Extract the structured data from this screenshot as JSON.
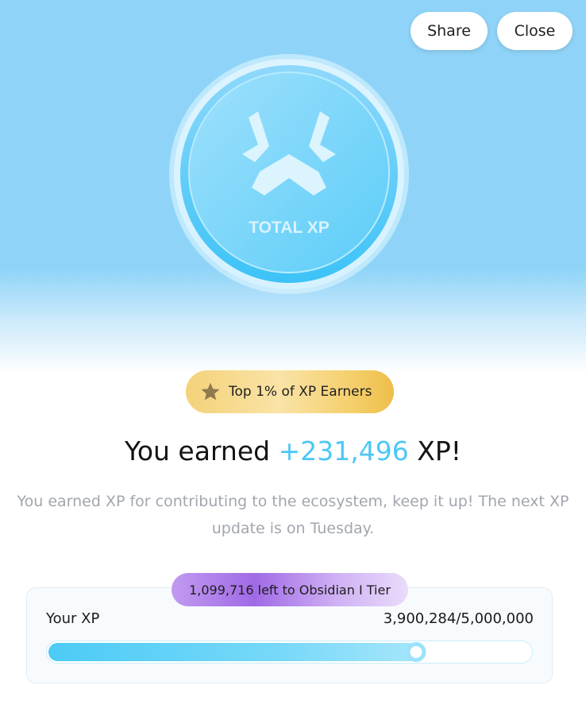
{
  "header": {
    "share_label": "Share",
    "close_label": "Close"
  },
  "coin": {
    "label": "TOTAL XP",
    "icon": "xp-logo-icon"
  },
  "badge": {
    "icon": "star-icon",
    "text": "Top 1% of XP Earners"
  },
  "earned": {
    "prefix": "You earned ",
    "amount": "+231,496",
    "suffix": " XP!"
  },
  "description": "You earned XP for contributing to the ecosystem, keep it up! The next XP update is on Tuesday.",
  "progress": {
    "tier_message": "1,099,716 left to Obsidian I Tier",
    "label": "Your XP",
    "value_text": "3,900,284/5,000,000",
    "current": 3900284,
    "max": 5000000
  },
  "colors": {
    "accent": "#4dc7f5",
    "badge_gold": "#f4d27a",
    "tier_purple": "#a06ae6"
  }
}
